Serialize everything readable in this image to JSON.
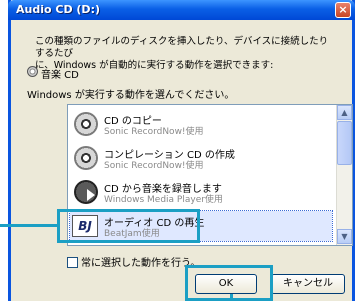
{
  "window": {
    "title": "Audio CD (D:)",
    "close_glyph": "×"
  },
  "intro_text": "この種類のファイルのディスクを挿入したり、デバイスに接続したりするたび\nに、Windows が自動的に実行する動作を選択できます:",
  "content_type": "音楽 CD",
  "prompt": "Windows が実行する動作を選んでください。",
  "actions": [
    {
      "title": "CD のコピー",
      "subtitle": "Sonic RecordNow!使用",
      "icon": "cd-icon"
    },
    {
      "title": "コンピレーション CD の作成",
      "subtitle": "Sonic RecordNow!使用",
      "icon": "cd-icon"
    },
    {
      "title": "CD から音楽を録音します",
      "subtitle": "Windows Media Player使用",
      "icon": "media-player-icon"
    },
    {
      "title": "オーディオ CD の再生",
      "subtitle": "BeatJam使用",
      "icon": "beatjam-icon",
      "icon_text": "BJ",
      "selected": true
    }
  ],
  "scroll": {
    "up": "▲",
    "down": "▼"
  },
  "always_do": "常に選択した動作を行う。",
  "buttons": {
    "ok": "OK",
    "cancel": "キャンセル"
  },
  "colors": {
    "accent": "#1b9fc4",
    "titlebar": "#0a5fe6"
  }
}
